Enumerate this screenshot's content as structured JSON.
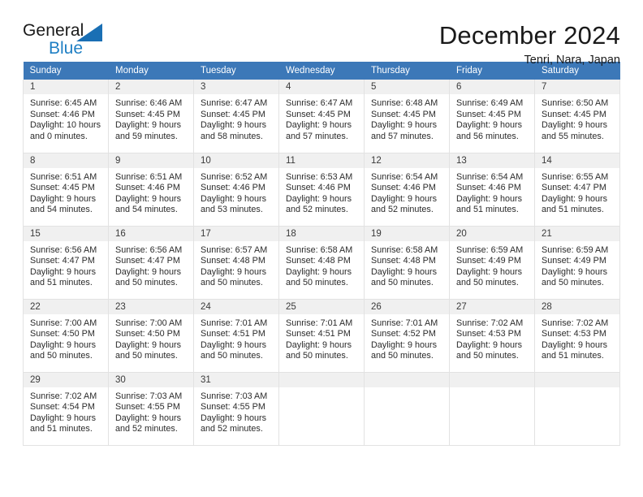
{
  "brand": {
    "name_part1": "General",
    "name_part2": "Blue",
    "triangle_color": "#1a6fb4",
    "blue_color": "#1f7fc4"
  },
  "header": {
    "title": "December 2024",
    "location": "Tenri, Nara, Japan"
  },
  "theme": {
    "header_bg": "#3c78b8",
    "header_text": "#ffffff",
    "daynum_bg": "#f0f0f0",
    "cell_border": "#e2e2e2"
  },
  "weekdays": [
    "Sunday",
    "Monday",
    "Tuesday",
    "Wednesday",
    "Thursday",
    "Friday",
    "Saturday"
  ],
  "weeks": [
    [
      {
        "day": "1",
        "sunrise": "Sunrise: 6:45 AM",
        "sunset": "Sunset: 4:46 PM",
        "daylight_line1": "Daylight: 10 hours",
        "daylight_line2": "and 0 minutes."
      },
      {
        "day": "2",
        "sunrise": "Sunrise: 6:46 AM",
        "sunset": "Sunset: 4:45 PM",
        "daylight_line1": "Daylight: 9 hours",
        "daylight_line2": "and 59 minutes."
      },
      {
        "day": "3",
        "sunrise": "Sunrise: 6:47 AM",
        "sunset": "Sunset: 4:45 PM",
        "daylight_line1": "Daylight: 9 hours",
        "daylight_line2": "and 58 minutes."
      },
      {
        "day": "4",
        "sunrise": "Sunrise: 6:47 AM",
        "sunset": "Sunset: 4:45 PM",
        "daylight_line1": "Daylight: 9 hours",
        "daylight_line2": "and 57 minutes."
      },
      {
        "day": "5",
        "sunrise": "Sunrise: 6:48 AM",
        "sunset": "Sunset: 4:45 PM",
        "daylight_line1": "Daylight: 9 hours",
        "daylight_line2": "and 57 minutes."
      },
      {
        "day": "6",
        "sunrise": "Sunrise: 6:49 AM",
        "sunset": "Sunset: 4:45 PM",
        "daylight_line1": "Daylight: 9 hours",
        "daylight_line2": "and 56 minutes."
      },
      {
        "day": "7",
        "sunrise": "Sunrise: 6:50 AM",
        "sunset": "Sunset: 4:45 PM",
        "daylight_line1": "Daylight: 9 hours",
        "daylight_line2": "and 55 minutes."
      }
    ],
    [
      {
        "day": "8",
        "sunrise": "Sunrise: 6:51 AM",
        "sunset": "Sunset: 4:45 PM",
        "daylight_line1": "Daylight: 9 hours",
        "daylight_line2": "and 54 minutes."
      },
      {
        "day": "9",
        "sunrise": "Sunrise: 6:51 AM",
        "sunset": "Sunset: 4:46 PM",
        "daylight_line1": "Daylight: 9 hours",
        "daylight_line2": "and 54 minutes."
      },
      {
        "day": "10",
        "sunrise": "Sunrise: 6:52 AM",
        "sunset": "Sunset: 4:46 PM",
        "daylight_line1": "Daylight: 9 hours",
        "daylight_line2": "and 53 minutes."
      },
      {
        "day": "11",
        "sunrise": "Sunrise: 6:53 AM",
        "sunset": "Sunset: 4:46 PM",
        "daylight_line1": "Daylight: 9 hours",
        "daylight_line2": "and 52 minutes."
      },
      {
        "day": "12",
        "sunrise": "Sunrise: 6:54 AM",
        "sunset": "Sunset: 4:46 PM",
        "daylight_line1": "Daylight: 9 hours",
        "daylight_line2": "and 52 minutes."
      },
      {
        "day": "13",
        "sunrise": "Sunrise: 6:54 AM",
        "sunset": "Sunset: 4:46 PM",
        "daylight_line1": "Daylight: 9 hours",
        "daylight_line2": "and 51 minutes."
      },
      {
        "day": "14",
        "sunrise": "Sunrise: 6:55 AM",
        "sunset": "Sunset: 4:47 PM",
        "daylight_line1": "Daylight: 9 hours",
        "daylight_line2": "and 51 minutes."
      }
    ],
    [
      {
        "day": "15",
        "sunrise": "Sunrise: 6:56 AM",
        "sunset": "Sunset: 4:47 PM",
        "daylight_line1": "Daylight: 9 hours",
        "daylight_line2": "and 51 minutes."
      },
      {
        "day": "16",
        "sunrise": "Sunrise: 6:56 AM",
        "sunset": "Sunset: 4:47 PM",
        "daylight_line1": "Daylight: 9 hours",
        "daylight_line2": "and 50 minutes."
      },
      {
        "day": "17",
        "sunrise": "Sunrise: 6:57 AM",
        "sunset": "Sunset: 4:48 PM",
        "daylight_line1": "Daylight: 9 hours",
        "daylight_line2": "and 50 minutes."
      },
      {
        "day": "18",
        "sunrise": "Sunrise: 6:58 AM",
        "sunset": "Sunset: 4:48 PM",
        "daylight_line1": "Daylight: 9 hours",
        "daylight_line2": "and 50 minutes."
      },
      {
        "day": "19",
        "sunrise": "Sunrise: 6:58 AM",
        "sunset": "Sunset: 4:48 PM",
        "daylight_line1": "Daylight: 9 hours",
        "daylight_line2": "and 50 minutes."
      },
      {
        "day": "20",
        "sunrise": "Sunrise: 6:59 AM",
        "sunset": "Sunset: 4:49 PM",
        "daylight_line1": "Daylight: 9 hours",
        "daylight_line2": "and 50 minutes."
      },
      {
        "day": "21",
        "sunrise": "Sunrise: 6:59 AM",
        "sunset": "Sunset: 4:49 PM",
        "daylight_line1": "Daylight: 9 hours",
        "daylight_line2": "and 50 minutes."
      }
    ],
    [
      {
        "day": "22",
        "sunrise": "Sunrise: 7:00 AM",
        "sunset": "Sunset: 4:50 PM",
        "daylight_line1": "Daylight: 9 hours",
        "daylight_line2": "and 50 minutes."
      },
      {
        "day": "23",
        "sunrise": "Sunrise: 7:00 AM",
        "sunset": "Sunset: 4:50 PM",
        "daylight_line1": "Daylight: 9 hours",
        "daylight_line2": "and 50 minutes."
      },
      {
        "day": "24",
        "sunrise": "Sunrise: 7:01 AM",
        "sunset": "Sunset: 4:51 PM",
        "daylight_line1": "Daylight: 9 hours",
        "daylight_line2": "and 50 minutes."
      },
      {
        "day": "25",
        "sunrise": "Sunrise: 7:01 AM",
        "sunset": "Sunset: 4:51 PM",
        "daylight_line1": "Daylight: 9 hours",
        "daylight_line2": "and 50 minutes."
      },
      {
        "day": "26",
        "sunrise": "Sunrise: 7:01 AM",
        "sunset": "Sunset: 4:52 PM",
        "daylight_line1": "Daylight: 9 hours",
        "daylight_line2": "and 50 minutes."
      },
      {
        "day": "27",
        "sunrise": "Sunrise: 7:02 AM",
        "sunset": "Sunset: 4:53 PM",
        "daylight_line1": "Daylight: 9 hours",
        "daylight_line2": "and 50 minutes."
      },
      {
        "day": "28",
        "sunrise": "Sunrise: 7:02 AM",
        "sunset": "Sunset: 4:53 PM",
        "daylight_line1": "Daylight: 9 hours",
        "daylight_line2": "and 51 minutes."
      }
    ],
    [
      {
        "day": "29",
        "sunrise": "Sunrise: 7:02 AM",
        "sunset": "Sunset: 4:54 PM",
        "daylight_line1": "Daylight: 9 hours",
        "daylight_line2": "and 51 minutes."
      },
      {
        "day": "30",
        "sunrise": "Sunrise: 7:03 AM",
        "sunset": "Sunset: 4:55 PM",
        "daylight_line1": "Daylight: 9 hours",
        "daylight_line2": "and 52 minutes."
      },
      {
        "day": "31",
        "sunrise": "Sunrise: 7:03 AM",
        "sunset": "Sunset: 4:55 PM",
        "daylight_line1": "Daylight: 9 hours",
        "daylight_line2": "and 52 minutes."
      },
      {
        "day": "",
        "sunrise": "",
        "sunset": "",
        "daylight_line1": "",
        "daylight_line2": ""
      },
      {
        "day": "",
        "sunrise": "",
        "sunset": "",
        "daylight_line1": "",
        "daylight_line2": ""
      },
      {
        "day": "",
        "sunrise": "",
        "sunset": "",
        "daylight_line1": "",
        "daylight_line2": ""
      },
      {
        "day": "",
        "sunrise": "",
        "sunset": "",
        "daylight_line1": "",
        "daylight_line2": ""
      }
    ]
  ]
}
